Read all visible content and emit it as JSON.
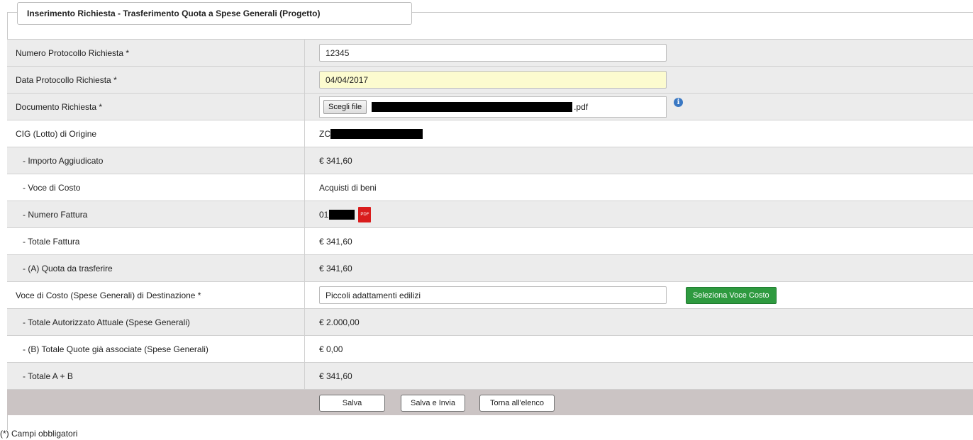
{
  "legend": "Inserimento Richiesta - Trasferimento Quota a Spese Generali (Progetto)",
  "fields": {
    "numero_protocollo": {
      "label": "Numero Protocollo Richiesta *",
      "value": "12345"
    },
    "data_protocollo": {
      "label": "Data Protocollo Richiesta *",
      "value": "04/04/2017"
    },
    "documento": {
      "label": "Documento Richiesta *",
      "button": "Scegli file",
      "filename_ext": ".pdf",
      "info_icon": "i"
    },
    "cig": {
      "label": "CIG (Lotto) di Origine",
      "value": "ZC"
    },
    "importo": {
      "label": "- Importo Aggiudicato",
      "value": "€ 341,60"
    },
    "voce_costo": {
      "label": "- Voce di Costo",
      "value": "Acquisti di beni"
    },
    "numero_fattura": {
      "label": "- Numero Fattura",
      "value": "01",
      "pdf_icon": "PDF"
    },
    "totale_fattura": {
      "label": "- Totale Fattura",
      "value": "€ 341,60"
    },
    "quota": {
      "label": "- (A) Quota da trasferire",
      "value": "€ 341,60"
    },
    "voce_dest": {
      "label": "Voce di Costo (Spese Generali) di Destinazione *",
      "value": "Piccoli adattamenti edilizi",
      "button": "Seleziona Voce Costo"
    },
    "totale_autorizzato": {
      "label": "- Totale Autorizzato Attuale (Spese Generali)",
      "value": "€ 2.000,00"
    },
    "totale_quote": {
      "label": "- (B) Totale Quote già associate (Spese Generali)",
      "value": "€ 0,00"
    },
    "totale_ab": {
      "label": "- Totale A + B",
      "value": "€ 341,60"
    }
  },
  "buttons": {
    "salva": "Salva",
    "salva_invia": "Salva e Invia",
    "torna": "Torna all'elenco"
  },
  "note": "(*) Campi obbligatori",
  "colors": {
    "accent_green": "#2e9a3f",
    "highlight_yellow": "#fcfbcf",
    "footer_bar": "#cbc4c4",
    "pdf_red": "#d91c1c"
  }
}
